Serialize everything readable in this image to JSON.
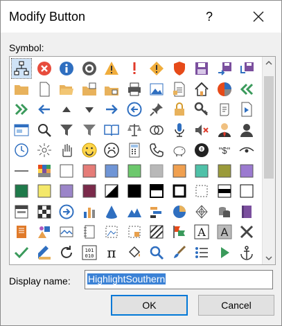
{
  "dialog": {
    "title": "Modify Button",
    "help_glyph": "?",
    "symbol_label": "Symbol:",
    "display_name_label": "Display name:",
    "display_name_value": "HighlightSouthern",
    "ok_label": "OK",
    "cancel_label": "Cancel"
  },
  "symbols": [
    [
      "org-chart-icon",
      "stop-circle-red-icon",
      "info-circle-blue-icon",
      "stop-gray-icon",
      "warning-triangle-icon",
      "exclamation-red-icon",
      "warning-diamond-icon",
      "shield-red-icon",
      "save-disk-icon",
      "save-swap-icon",
      "save-arrow-icon",
      ""
    ],
    [
      "folder-icon",
      "blank-page-icon",
      "folder-open-icon",
      "folder-move-icon",
      "folder-new-icon",
      "printer-icon",
      "picture-icon",
      "document-lines-icon",
      "home-icon",
      "pie-chart-icon",
      "double-left-green-icon",
      ""
    ],
    [
      "double-right-green-icon",
      "arrow-left-blue-icon",
      "triangle-up-icon",
      "triangle-down-icon",
      "arrow-right-blue-icon",
      "arrow-left-circle-icon",
      "pushpin-icon",
      "padlock-icon",
      "key-icon",
      "scroll-icon",
      "play-page-icon",
      ""
    ],
    [
      "form-icon",
      "magnifier-icon",
      "filter-icon",
      "filter-clear-icon",
      "book-open-icon",
      "scales-icon",
      "rings-icon",
      "microphone-icon",
      "speaker-mute-icon",
      "person-tie-icon",
      "person-silhouette-icon",
      ""
    ],
    [
      "clock-icon",
      "sparkle-icon",
      "hand-icon",
      "smiley-icon",
      "sad-face-icon",
      "calculator-icon",
      "phone-icon",
      "piggy-bank-icon",
      "eight-ball-icon",
      "dollar-quote-icon",
      "eye-icon",
      ""
    ],
    [
      "line-icon",
      "mosaic-icon",
      "white-square-icon",
      "salmon-square-icon",
      "blue-square-icon",
      "green-square-icon",
      "gray-square-icon",
      "orange-square-icon",
      "teal-square-icon",
      "olive-square-icon",
      "purple-square-icon",
      ""
    ],
    [
      "dark-green-square-icon",
      "yellow-square-icon",
      "lavender-square-icon",
      "maroon-square-icon",
      "half-black-square-icon",
      "black-square-icon",
      "top-bar-square-icon",
      "bold-outline-square-icon",
      "dotted-square-icon",
      "middle-bar-square-icon",
      "thin-outline-square-icon",
      ""
    ],
    [
      "header-bar-icon",
      "checker-icon",
      "arrow-circle-right-icon",
      "bar-chart-icon",
      "cone-icon",
      "mountain-chart-icon",
      "timeline-icon",
      "pie-outline-icon",
      "web-icon",
      "cylinders-icon",
      "purple-book-icon",
      ""
    ],
    [
      "orange-book-icon",
      "shapes-icon",
      "line-picture-icon",
      "notes-page-icon",
      "dotted-picture-icon",
      "dotted-square-orange-icon",
      "striped-icon",
      "flags-icon",
      "letter-a-outline-icon",
      "letter-a-gray-icon",
      "cross-tools-icon",
      ""
    ],
    [
      "checkmark-icon",
      "pencil-ruler-icon",
      "refresh-icon",
      "binary-icon",
      "pi-icon",
      "paint-bucket-icon",
      "search-blue-icon",
      "brush-icon",
      "bullet-list-icon",
      "play-green-icon",
      "anchor-icon",
      ""
    ]
  ],
  "colors": {
    "accent": "#0078d7",
    "selection": "#3b82d6"
  }
}
